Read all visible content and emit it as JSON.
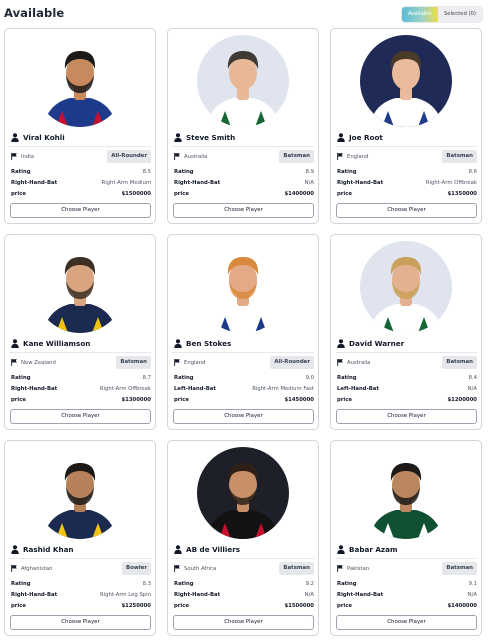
{
  "header": {
    "title": "Available",
    "available_label": "Available",
    "selected_label": "Selected (0)"
  },
  "labels": {
    "rating": "Rating",
    "price": "price",
    "choose_button": "Choose Player"
  },
  "icons": {
    "person": "person-icon",
    "country": "flag-icon"
  },
  "players": [
    {
      "name": "Viral Kohli",
      "country": "India",
      "role": "All-Rounder",
      "rating": "8.5",
      "batting": "Right-Hand-Bat",
      "bowling": "Right-Arm Medium",
      "price": "$1500000"
    },
    {
      "name": "Steve Smith",
      "country": "Australia",
      "role": "Batsman",
      "rating": "8.9",
      "batting": "Right-Hand-Bat",
      "bowling": "N/A",
      "price": "$1400000"
    },
    {
      "name": "Joe Root",
      "country": "England",
      "role": "Batsman",
      "rating": "8.6",
      "batting": "Right-Hand-Bat",
      "bowling": "Right-Arm Offbreak",
      "price": "$1350000"
    },
    {
      "name": "Kane Williamson",
      "country": "New Zealand",
      "role": "Batsman",
      "rating": "8.7",
      "batting": "Right-Hand-Bat",
      "bowling": "Right-Arm Offbreak",
      "price": "$1300000"
    },
    {
      "name": "Ben Stokes",
      "country": "England",
      "role": "All-Rounder",
      "rating": "9.0",
      "batting": "Left-Hand-Bat",
      "bowling": "Right-Arm Medium Fast",
      "price": "$1450000"
    },
    {
      "name": "David Warner",
      "country": "Australia",
      "role": "Batsman",
      "rating": "8.4",
      "batting": "Left-Hand-Bat",
      "bowling": "N/A",
      "price": "$1200000"
    },
    {
      "name": "Rashid Khan",
      "country": "Afghanistan",
      "role": "Bowler",
      "rating": "8.3",
      "batting": "Right-Hand-Bat",
      "bowling": "Right-Arm Leg Spin",
      "price": "$1250000"
    },
    {
      "name": "AB de Villiers",
      "country": "South Africa",
      "role": "Batsman",
      "rating": "9.2",
      "batting": "Right-Hand-Bat",
      "bowling": "N/A",
      "price": "$1500000"
    },
    {
      "name": "Babar Azam",
      "country": "Pakistan",
      "role": "Batsman",
      "rating": "9.1",
      "batting": "Right-Hand-Bat",
      "bowling": "N/A",
      "price": "$1400000"
    }
  ],
  "photos": [
    {
      "bg": "#ffffff",
      "jersey": "#1e3a8a",
      "accent": "#c8102e",
      "skin": "#c68a5e",
      "hair": "#1c1917",
      "beard": true
    },
    {
      "bg": "#dfe4ee",
      "jersey": "#ffffff",
      "accent": "#166534",
      "skin": "#e8b896",
      "hair": "#3f3a35",
      "beard": false
    },
    {
      "bg": "#1f2a57",
      "jersey": "#ffffff",
      "accent": "#1e3a8a",
      "skin": "#e9bb9c",
      "hair": "#4a3a2a",
      "beard": false
    },
    {
      "bg": "#ffffff",
      "jersey": "#1b2a4e",
      "accent": "#f1c40f",
      "skin": "#d9a57e",
      "hair": "#3b2f25",
      "beard": true
    },
    {
      "bg": "#ffffff",
      "jersey": "#ffffff",
      "accent": "#1e3a8a",
      "skin": "#e4a986",
      "hair": "#d9893c",
      "beard": true
    },
    {
      "bg": "#dfe4ee",
      "jersey": "#ffffff",
      "accent": "#166534",
      "skin": "#e3b090",
      "hair": "#c9a15b",
      "beard": true
    },
    {
      "bg": "#ffffff",
      "jersey": "#1b2a4e",
      "accent": "#f1c40f",
      "skin": "#b5805a",
      "hair": "#1c1917",
      "beard": true
    },
    {
      "bg": "#1d1f29",
      "jersey": "#121212",
      "accent": "#c8102e",
      "skin": "#c98f67",
      "hair": "#2c2018",
      "beard": true
    },
    {
      "bg": "#ffffff",
      "jersey": "#0f5132",
      "accent": "#ffffff",
      "skin": "#b98660",
      "hair": "#1c1917",
      "beard": true
    }
  ]
}
